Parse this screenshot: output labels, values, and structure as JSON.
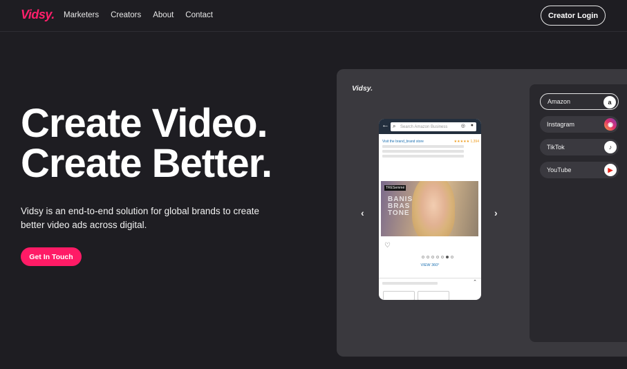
{
  "nav": {
    "logo": "Vidsy.",
    "links": [
      "Marketers",
      "Creators",
      "About",
      "Contact"
    ],
    "login_label": "Creator Login"
  },
  "hero": {
    "title_line1": "Create Video.",
    "title_line2": "Create Better.",
    "subtitle": "Vidsy is an end-to-end solution for global brands to create better video ads across digital.",
    "cta_label": "Get In Touch"
  },
  "demo": {
    "panel_logo": "Vidsy.",
    "platforms": [
      {
        "label": "Amazon",
        "icon": "amazon-icon",
        "glyph": "a",
        "active": true
      },
      {
        "label": "Instagram",
        "icon": "instagram-icon",
        "glyph": "◉",
        "active": false
      },
      {
        "label": "TikTok",
        "icon": "tiktok-icon",
        "glyph": "♪",
        "active": false
      },
      {
        "label": "YouTube",
        "icon": "youtube-icon",
        "glyph": "▶",
        "active": false
      }
    ],
    "phone": {
      "search_placeholder": "Search Amazon Business",
      "brand_link": "Visit the brand_brand store",
      "rating": "★★★★★ 1,394",
      "product_tag": "TRESemmé",
      "product_text_1": "BANIS",
      "product_text_2": "BRAS",
      "product_text_3": "TONE",
      "view_360": "VIEW 360°"
    }
  },
  "colors": {
    "accent": "#ff1b66",
    "background": "#1e1d22",
    "panel": "#3a393e"
  }
}
